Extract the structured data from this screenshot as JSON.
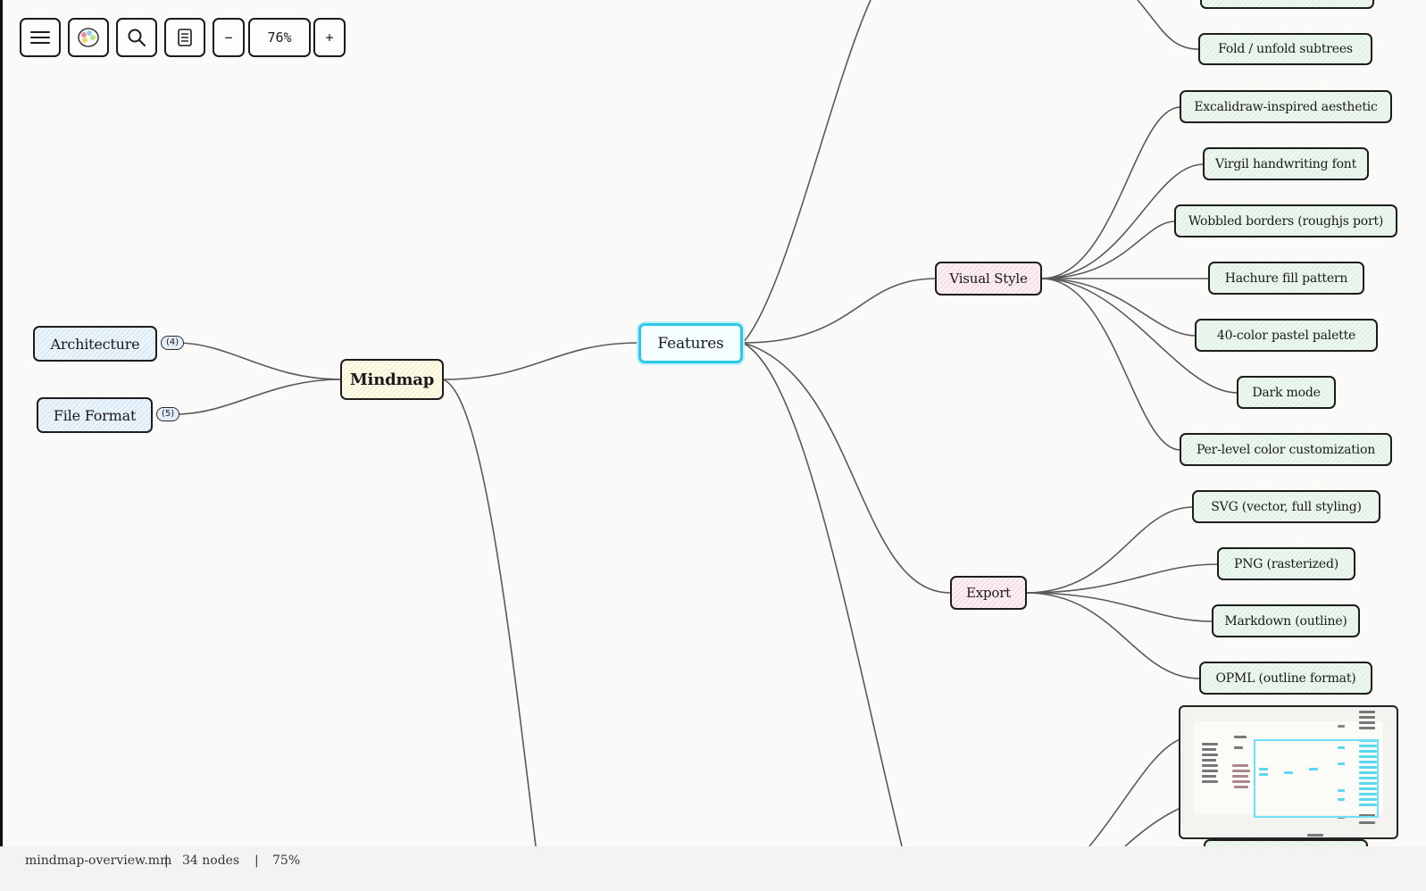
{
  "toolbar": {
    "menu_icon": "hamburger-menu-icon",
    "palette_icon": "color-palette-icon",
    "search_icon": "search-icon",
    "outline_icon": "document-outline-icon",
    "zoom_out_label": "−",
    "zoom_level": "76%",
    "zoom_in_label": "+"
  },
  "nodes": {
    "architecture": "Architecture",
    "architecture_badge": "(4)",
    "file_format": "File Format",
    "file_format_badge": "(5)",
    "mindmap": "Mindmap",
    "features": "Features",
    "visual_style": "Visual Style",
    "export": "Export",
    "fold_unfold": "Fold / unfold subtrees",
    "excalidraw": "Excalidraw-inspired aesthetic",
    "virgil": "Virgil handwriting font",
    "wobbled": "Wobbled borders (roughjs port)",
    "hachure": "Hachure fill pattern",
    "palette40": "40-color pastel palette",
    "dark_mode": "Dark mode",
    "per_level": "Per-level color customization",
    "svg": "SVG (vector, full styling)",
    "png": "PNG (rasterized)",
    "markdown": "Markdown (outline)",
    "opml": "OPML (outline format)"
  },
  "colors": {
    "selected_border": "#29c9e8",
    "edge": "#5a5a5a",
    "leaf_fill": "#d8eedc",
    "branch_fill": "#f2d6de",
    "left_fill": "#cfe3f3",
    "root_fill": "#f1ecc4"
  },
  "statusbar": {
    "filename": "mindmap-overview.mm",
    "sep1": "|",
    "node_count": "34 nodes",
    "sep2": "|",
    "zoom": "75%"
  }
}
